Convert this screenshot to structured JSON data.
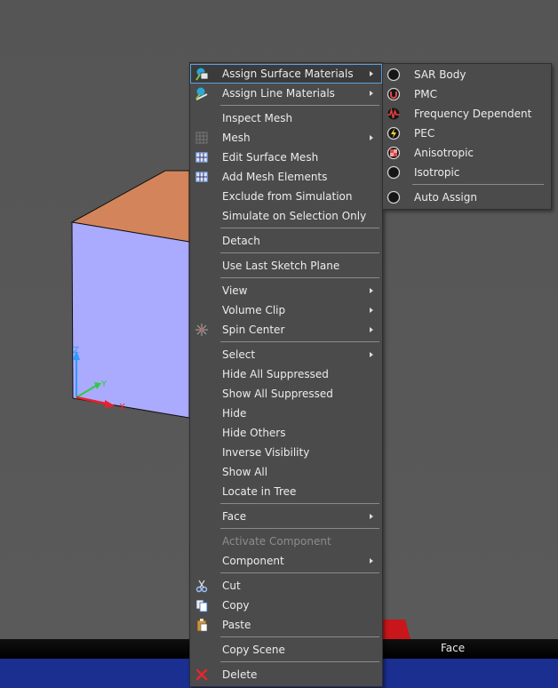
{
  "context_menu": {
    "items": [
      {
        "label": "Assign Surface Materials",
        "submenu": true,
        "highlighted": true,
        "icon": "assign-surface-material-icon"
      },
      {
        "label": "Assign Line Materials",
        "submenu": true,
        "icon": "assign-line-material-icon"
      },
      {
        "separator": true
      },
      {
        "label": "Inspect Mesh"
      },
      {
        "label": "Mesh",
        "submenu": true,
        "icon": "mesh-grid-icon"
      },
      {
        "label": "Edit Surface Mesh",
        "icon": "edit-mesh-icon"
      },
      {
        "label": "Add Mesh Elements",
        "icon": "add-mesh-icon"
      },
      {
        "label": "Exclude from Simulation"
      },
      {
        "label": "Simulate on Selection Only"
      },
      {
        "separator": true
      },
      {
        "label": "Detach"
      },
      {
        "separator": true
      },
      {
        "label": "Use Last Sketch Plane"
      },
      {
        "separator": true
      },
      {
        "label": "View",
        "submenu": true
      },
      {
        "label": "Volume Clip",
        "submenu": true
      },
      {
        "label": "Spin Center",
        "submenu": true,
        "icon": "spin-center-icon"
      },
      {
        "separator": true
      },
      {
        "label": "Select",
        "submenu": true
      },
      {
        "label": "Hide All Suppressed"
      },
      {
        "label": "Show All Suppressed"
      },
      {
        "label": "Hide"
      },
      {
        "label": "Hide Others"
      },
      {
        "label": "Inverse Visibility"
      },
      {
        "label": "Show All"
      },
      {
        "label": "Locate in Tree"
      },
      {
        "separator": true
      },
      {
        "label": "Face",
        "submenu": true
      },
      {
        "separator": true
      },
      {
        "label": "Activate Component",
        "disabled": true
      },
      {
        "label": "Component",
        "submenu": true
      },
      {
        "separator": true
      },
      {
        "label": "Cut",
        "icon": "scissors-icon"
      },
      {
        "label": "Copy",
        "icon": "copy-icon"
      },
      {
        "label": "Paste",
        "icon": "paste-icon"
      },
      {
        "separator": true
      },
      {
        "label": "Copy Scene"
      },
      {
        "separator": true
      },
      {
        "label": "Delete",
        "icon": "delete-x-icon"
      }
    ]
  },
  "submenu": {
    "items": [
      {
        "label": "SAR Body",
        "icon": "sar-body-icon"
      },
      {
        "label": "PMC",
        "icon": "pmc-magnet-icon"
      },
      {
        "label": "Frequency Dependent",
        "icon": "frequency-wave-icon"
      },
      {
        "label": "PEC",
        "icon": "pec-lightning-icon"
      },
      {
        "label": "Anisotropic",
        "icon": "anisotropic-checker-icon"
      },
      {
        "label": "Isotropic",
        "icon": "isotropic-circle-icon"
      },
      {
        "separator": true
      },
      {
        "label": "Auto Assign",
        "icon": "auto-assign-icon"
      }
    ]
  },
  "status_bar": {
    "text": "Face"
  },
  "axes": {
    "x": "X",
    "y": "Y",
    "z": "Z"
  },
  "colors": {
    "cube_front": "#aaaaff",
    "cube_top": "#d4845a",
    "menu_bg": "#4b4b4b",
    "highlight_border": "#5da0e0",
    "status_blue": "#1a2f8f"
  }
}
